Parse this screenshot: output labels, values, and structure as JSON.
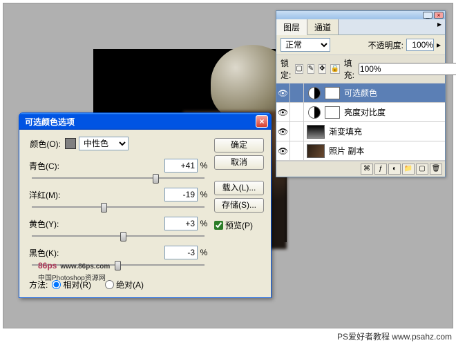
{
  "dialog": {
    "title": "可选颜色选项",
    "color_label": "颜色(O):",
    "color_selected": "中性色",
    "sliders": {
      "cyan": {
        "label": "青色(C):",
        "value": "+41",
        "pos": 70
      },
      "magenta": {
        "label": "洋红(M):",
        "value": "-19",
        "pos": 40
      },
      "yellow": {
        "label": "黄色(Y):",
        "value": "+3",
        "pos": 51
      },
      "black": {
        "label": "黑色(K):",
        "value": "-3",
        "pos": 48
      }
    },
    "method_label": "方法:",
    "method_rel": "相对(R)",
    "method_abs": "绝对(A)",
    "btn_ok": "确定",
    "btn_cancel": "取消",
    "btn_load": "载入(L)...",
    "btn_save": "存储(S)...",
    "preview_label": "预览(P)"
  },
  "panel": {
    "tab_layers": "图层",
    "tab_channels": "通道",
    "blend_mode": "正常",
    "opacity_label": "不透明度:",
    "opacity_value": "100%",
    "lock_label": "锁定:",
    "fill_label": "填充:",
    "fill_value": "100%",
    "layers": {
      "l0": "可选颜色",
      "l1": "亮度对比度",
      "l2": "渐变填充",
      "l3": "照片 副本"
    }
  },
  "footer": {
    "text": "PS爱好者教程  www.psahz.com"
  },
  "watermark": {
    "brand": "86ps",
    "url": "www.86ps.com",
    "sub": "中国Photoshop资源网"
  }
}
